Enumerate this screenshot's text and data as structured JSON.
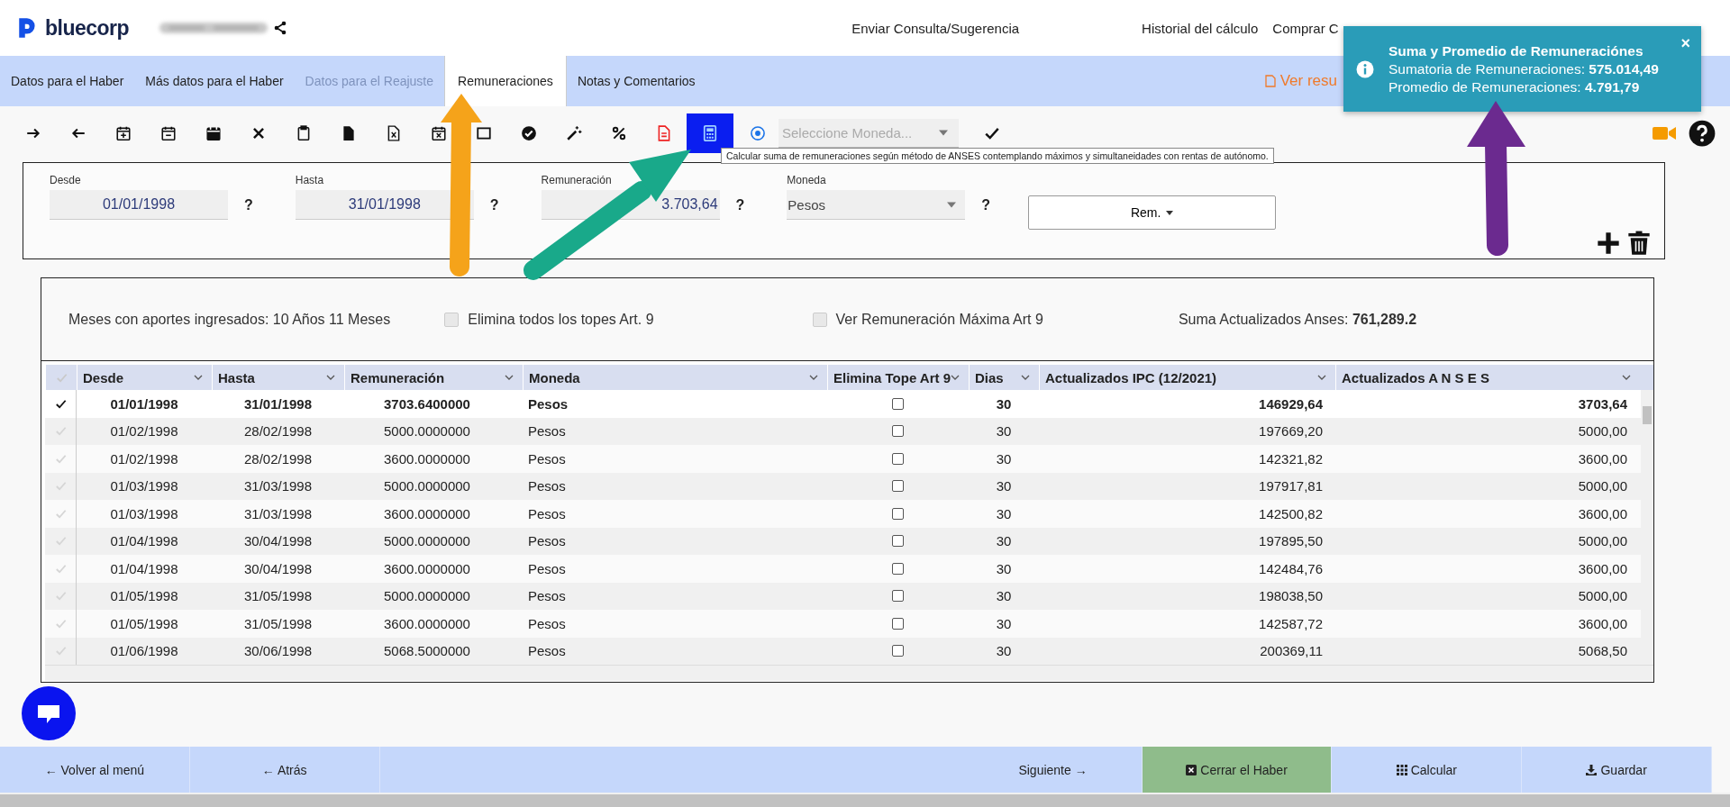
{
  "header": {
    "logo": "bluecorp",
    "links": [
      "Enviar Consulta/Sugerencia",
      "Historial del cálculo",
      "Comprar C"
    ]
  },
  "tabs": [
    {
      "label": "Datos para el Haber",
      "selected": false,
      "disabled": false
    },
    {
      "label": "Más datos para el Haber",
      "selected": false,
      "disabled": false
    },
    {
      "label": "Datos para el Reajuste",
      "selected": false,
      "disabled": true
    },
    {
      "label": "Remuneraciones",
      "selected": true,
      "disabled": false
    },
    {
      "label": "Notas y Comentarios",
      "selected": false,
      "disabled": false
    }
  ],
  "report_link": "Ver resu",
  "toast": {
    "title": "Suma y Promedio de Remuneraciónes",
    "close": "×",
    "lines": [
      "Sumatoria de Remuneraciones: **575.014,49**",
      "Promedio de Remuneraciones: **4.791,79**"
    ]
  },
  "toolbar": {
    "currency_placeholder": "Seleccione Moneda...",
    "tooltip": "Calcular suma de remuneraciones según método de ANSES contemplando máximos y simultaneidades con rentas de autónomo."
  },
  "form": {
    "help": "?",
    "rem_button": "Rem.",
    "fields": [
      {
        "label": "Desde",
        "value": "01/01/1998",
        "kind": "date"
      },
      {
        "label": "Hasta",
        "value": "31/01/1998",
        "kind": "date"
      },
      {
        "label": "Remuneración",
        "value": "3.703,64",
        "kind": "amount"
      },
      {
        "label": "Moneda",
        "value": "Pesos",
        "kind": "select"
      }
    ]
  },
  "summary": {
    "months": "Meses con aportes ingresados: 10 Años 11 Meses",
    "options": [
      {
        "label": "Elimina todos los topes Art. 9",
        "checked": false
      },
      {
        "label": "Ver Remuneración Máxima Art 9",
        "checked": false
      }
    ],
    "total": "Suma Actualizados Anses: **761,289.2**"
  },
  "table": {
    "columns": [
      "Desde",
      "Hasta",
      "Remuneración",
      "Moneda",
      "Elimina Tope Art 9",
      "Dias",
      "Actualizados IPC (12/2021)",
      "Actualizados A N S E S"
    ],
    "rows": [
      {
        "selected": true,
        "elimina_tope": false,
        "cells": [
          "01/01/1998",
          "31/01/1998",
          "3703.6400000",
          "Pesos",
          "30",
          "146929,64",
          "3703,64"
        ]
      },
      {
        "selected": false,
        "elimina_tope": false,
        "cells": [
          "01/02/1998",
          "28/02/1998",
          "5000.0000000",
          "Pesos",
          "30",
          "197669,20",
          "5000,00"
        ]
      },
      {
        "selected": false,
        "elimina_tope": false,
        "cells": [
          "01/02/1998",
          "28/02/1998",
          "3600.0000000",
          "Pesos",
          "30",
          "142321,82",
          "3600,00"
        ]
      },
      {
        "selected": false,
        "elimina_tope": false,
        "cells": [
          "01/03/1998",
          "31/03/1998",
          "5000.0000000",
          "Pesos",
          "30",
          "197917,81",
          "5000,00"
        ]
      },
      {
        "selected": false,
        "elimina_tope": false,
        "cells": [
          "01/03/1998",
          "31/03/1998",
          "3600.0000000",
          "Pesos",
          "30",
          "142500,82",
          "3600,00"
        ]
      },
      {
        "selected": false,
        "elimina_tope": false,
        "cells": [
          "01/04/1998",
          "30/04/1998",
          "5000.0000000",
          "Pesos",
          "30",
          "197895,50",
          "5000,00"
        ]
      },
      {
        "selected": false,
        "elimina_tope": false,
        "cells": [
          "01/04/1998",
          "30/04/1998",
          "3600.0000000",
          "Pesos",
          "30",
          "142484,76",
          "3600,00"
        ]
      },
      {
        "selected": false,
        "elimina_tope": false,
        "cells": [
          "01/05/1998",
          "31/05/1998",
          "5000.0000000",
          "Pesos",
          "30",
          "198038,50",
          "5000,00"
        ]
      },
      {
        "selected": false,
        "elimina_tope": false,
        "cells": [
          "01/05/1998",
          "31/05/1998",
          "3600.0000000",
          "Pesos",
          "30",
          "142587,72",
          "3600,00"
        ]
      },
      {
        "selected": false,
        "elimina_tope": false,
        "cells": [
          "01/06/1998",
          "30/06/1998",
          "5068.5000000",
          "Pesos",
          "30",
          "200369,11",
          "5068,50"
        ]
      }
    ]
  },
  "footer": [
    {
      "label": "← Volver al menú",
      "kind": "plain"
    },
    {
      "label": "← Atrás",
      "kind": "plain"
    },
    {
      "label": "Siguiente →",
      "kind": "plain"
    },
    {
      "label": "Cerrar el Haber",
      "kind": "close"
    },
    {
      "label": "Calcular",
      "kind": "grid"
    },
    {
      "label": "Guardar",
      "kind": "download"
    }
  ]
}
